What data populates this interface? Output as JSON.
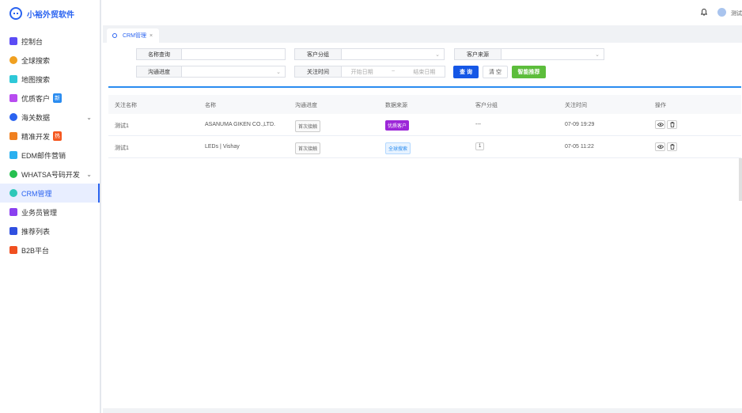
{
  "app": {
    "title": "小裕外贸软件"
  },
  "sidebar": {
    "items": [
      {
        "label": "控制台",
        "icon": "dashboard-icon",
        "color": "#5b4cf5"
      },
      {
        "label": "全球搜索",
        "icon": "globe-icon",
        "color": "#f0a020"
      },
      {
        "label": "地图搜索",
        "icon": "map-icon",
        "color": "#2ec8d8"
      },
      {
        "label": "优质客户",
        "icon": "book-icon",
        "color": "#b84cf0",
        "badge": "新"
      },
      {
        "label": "海关数据",
        "icon": "customs-icon",
        "color": "#2a63f0",
        "arrow": "⌄"
      },
      {
        "label": "精准开发",
        "icon": "people-icon",
        "color": "#f08020",
        "badge": "热"
      },
      {
        "label": "EDM邮件营销",
        "icon": "mail-icon",
        "color": "#2ab0f0"
      },
      {
        "label": "WHATSA号码开发",
        "icon": "whatsapp-icon",
        "color": "#25c050",
        "arrow": "⌄"
      },
      {
        "label": "CRM管理",
        "icon": "user-icon",
        "color": "#2ec8b8",
        "active": true
      },
      {
        "label": "业务员管理",
        "icon": "briefcase-icon",
        "color": "#8a40f0"
      },
      {
        "label": "推荐列表",
        "icon": "tree-icon",
        "color": "#3050e0"
      },
      {
        "label": "B2B平台",
        "icon": "b2b-icon",
        "color": "#f05020"
      }
    ]
  },
  "header": {
    "user_name": "测试"
  },
  "tabs": [
    {
      "label": "CRM管理",
      "close": "×"
    }
  ],
  "filters": {
    "name_query_label": "名称查询",
    "group_label": "客户分组",
    "source_label": "客户来源",
    "progress_label": "沟通进度",
    "time_label": "关注时间",
    "start_placeholder": "开始日期",
    "range_sep": "~",
    "end_placeholder": "结束日期"
  },
  "buttons": {
    "query": "查 询",
    "clear": "清 空",
    "smart": "智能推荐"
  },
  "table": {
    "headers": [
      "关注名称",
      "名称",
      "沟通进度",
      "数据来源",
      "客户分组",
      "关注时间",
      "操作"
    ],
    "rows": [
      {
        "follow_name": "测试1",
        "name": "ASANUMA GIKEN CO.,LTD.",
        "progress": "首次接触",
        "source": "优质客户",
        "group": "---",
        "time": "07-09 19:29"
      },
      {
        "follow_name": "测试1",
        "name": "LEDs | Vishay",
        "progress": "首次接触",
        "source": "全球搜索",
        "group": "1",
        "time": "07-05 11:22"
      }
    ]
  }
}
